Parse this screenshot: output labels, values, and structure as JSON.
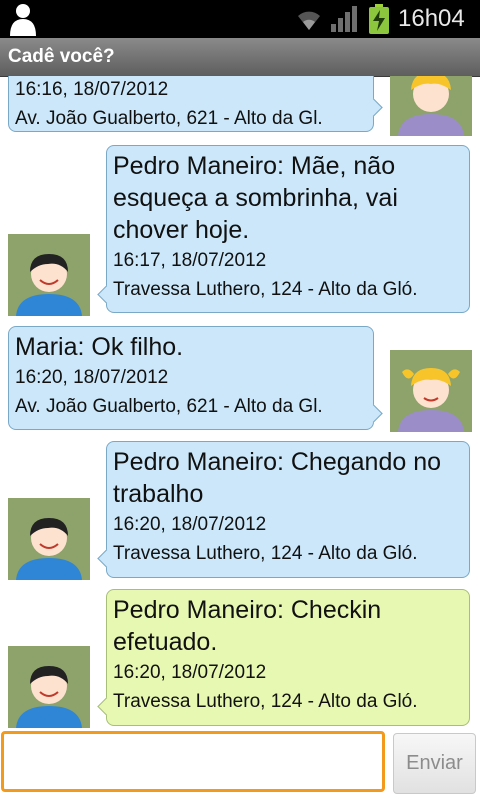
{
  "status_bar": {
    "time": "16h04",
    "icons": [
      "person-icon",
      "wifi-icon",
      "signal-icon",
      "battery-charging-icon"
    ]
  },
  "app": {
    "title": "Cadê você?"
  },
  "messages": [
    {
      "text": "",
      "time": "16:16, 18/07/2012",
      "address": "Av. João Gualberto, 621 - Alto da Gl.",
      "avatar": "girl-avatar"
    },
    {
      "text": "Pedro Maneiro: Mãe, não esqueça a sombrinha, vai chover hoje.",
      "time": "16:17, 18/07/2012",
      "address": "Travessa Luthero, 124 - Alto da Gló.",
      "avatar": "boy-avatar"
    },
    {
      "text": "Maria: Ok filho.",
      "time": "16:20, 18/07/2012",
      "address": "Av. João Gualberto, 621 - Alto da Gl.",
      "avatar": "girl-avatar"
    },
    {
      "text": "Pedro Maneiro: Chegando no trabalho",
      "time": "16:20, 18/07/2012",
      "address": "Travessa Luthero, 124 - Alto da Gló.",
      "avatar": "boy-avatar"
    },
    {
      "text": "Pedro Maneiro: Checkin efetuado.",
      "time": "16:20, 18/07/2012",
      "address": "Travessa Luthero, 124 - Alto da Gló.",
      "avatar": "boy-avatar"
    }
  ],
  "composer": {
    "value": "",
    "placeholder": "",
    "send_label": "Enviar"
  },
  "colors": {
    "bubble_blue": "#cbe7f9",
    "bubble_green": "#e7f8b3",
    "input_focus": "#f39a1c"
  }
}
